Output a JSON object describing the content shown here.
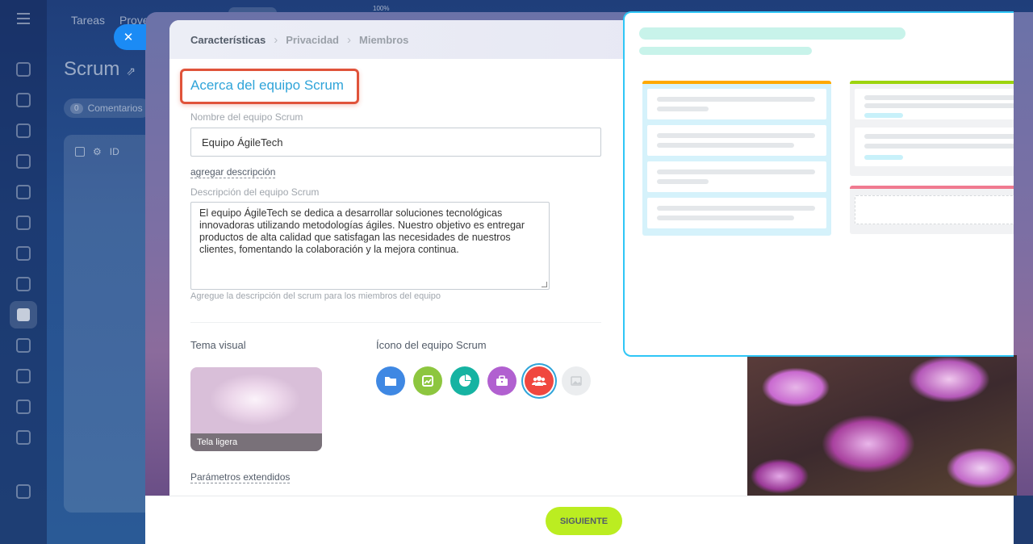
{
  "background": {
    "tabs": [
      "Tareas",
      "Prove"
    ],
    "title": "Scrum",
    "chip_count": "0",
    "chip_label": "Comentarios",
    "table_col": "ID",
    "zoom": "100%"
  },
  "wizard": {
    "steps": [
      "Características",
      "Privacidad",
      "Miembros"
    ],
    "section_title": "Acerca del equipo Scrum",
    "name_label": "Nombre del equipo Scrum",
    "name_value": "Equipo ÁgileTech",
    "add_description": "agregar descripción",
    "description_label": "Descripción del equipo Scrum",
    "description_value": "El equipo ÁgileTech se dedica a desarrollar soluciones tecnológicas innovadoras utilizando metodologías ágiles. Nuestro objetivo es entregar productos de alta calidad que satisfagan las necesidades de nuestros clientes, fomentando la colaboración y la mejora continua.",
    "description_hint": "Agregue la descripción del scrum para los miembros del equipo",
    "theme_heading": "Tema visual",
    "theme_name": "Tela ligera",
    "icon_heading": "Ícono del equipo Scrum",
    "icons": [
      {
        "name": "folder-icon",
        "color": "#3f88e3"
      },
      {
        "name": "chart-icon",
        "color": "#8dc63f"
      },
      {
        "name": "pie-chart-icon",
        "color": "#16b3a2"
      },
      {
        "name": "briefcase-icon",
        "color": "#b160d0"
      },
      {
        "name": "team-icon",
        "color": "#f0473f",
        "selected": true
      },
      {
        "name": "image-icon",
        "color": "#ebedef"
      }
    ],
    "extended_params": "Parámetros extendidos",
    "next_button": "SIGUIENTE"
  },
  "colors": {
    "accent": "#2fa4d9",
    "highlight_border": "#e0533a",
    "next_button": "#bbed21"
  }
}
